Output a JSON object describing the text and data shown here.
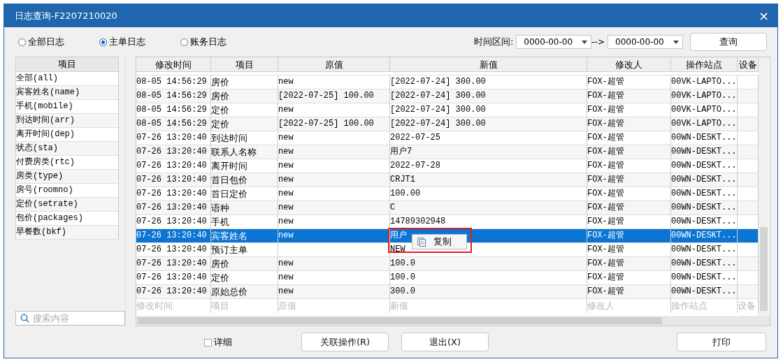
{
  "window": {
    "title": "日志查询-F2207210020",
    "close": "×"
  },
  "log_types": [
    {
      "label": "全部日志",
      "selected": false
    },
    {
      "label": "主单日志",
      "selected": true
    },
    {
      "label": "账务日志",
      "selected": false
    }
  ],
  "time_range": {
    "label": "时间区间:",
    "from": "0000-00-00",
    "arrow": "-->",
    "to": "0000-00-00"
  },
  "query_button": "查询",
  "item_list": {
    "header": "项目",
    "items": [
      {
        "label": "全部(all)",
        "selected": false
      },
      {
        "label": "宾客姓名(name)",
        "selected": false
      },
      {
        "label": "手机(mobile)",
        "selected": false
      },
      {
        "label": "到达时间(arr)",
        "selected": false
      },
      {
        "label": "离开时间(dep)",
        "selected": false
      },
      {
        "label": "状态(sta)",
        "selected": false
      },
      {
        "label": "付费房类(rtc)",
        "selected": false
      },
      {
        "label": "房类(type)",
        "selected": false
      },
      {
        "label": "房号(roomno)",
        "selected": false
      },
      {
        "label": "定价(setrate)",
        "selected": false
      },
      {
        "label": "包价(packages)",
        "selected": false
      },
      {
        "label": "早餐数(bkf)",
        "selected": false
      }
    ],
    "search": {
      "placeholder": "搜索内容"
    }
  },
  "table": {
    "columns": [
      "修改时间",
      "项目",
      "原值",
      "新值",
      "修改人",
      "操作站点",
      "设备"
    ],
    "rows": [
      {
        "time": "08-05 14:56:29",
        "item": "房价",
        "old": "new",
        "new": "[2022-07-24] 300.00",
        "user": "FOX-超管",
        "station": "00VK-LAPTO...",
        "selected": false
      },
      {
        "time": "08-05 14:56:29",
        "item": "房价",
        "old": "[2022-07-25] 100.00",
        "new": "[2022-07-24] 300.00",
        "user": "FOX-超管",
        "station": "00VK-LAPTO...",
        "selected": false
      },
      {
        "time": "08-05 14:56:29",
        "item": "定价",
        "old": "new",
        "new": "[2022-07-24] 300.00",
        "user": "FOX-超管",
        "station": "00VK-LAPTO...",
        "selected": false
      },
      {
        "time": "08-05 14:56:29",
        "item": "定价",
        "old": "[2022-07-25] 100.00",
        "new": "[2022-07-24] 300.00",
        "user": "FOX-超管",
        "station": "00VK-LAPTO...",
        "selected": false
      },
      {
        "time": "07-26 13:20:40",
        "item": "到达时间",
        "old": "new",
        "new": "2022-07-25",
        "user": "FOX-超管",
        "station": "00WN-DESKT...",
        "selected": false
      },
      {
        "time": "07-26 13:20:40",
        "item": "联系人名称",
        "old": "new",
        "new": "用户7",
        "user": "FOX-超管",
        "station": "00WN-DESKT...",
        "selected": false
      },
      {
        "time": "07-26 13:20:40",
        "item": "离开时间",
        "old": "new",
        "new": "2022-07-28",
        "user": "FOX-超管",
        "station": "00WN-DESKT...",
        "selected": false
      },
      {
        "time": "07-26 13:20:40",
        "item": "首日包价",
        "old": "new",
        "new": "CRJT1",
        "user": "FOX-超管",
        "station": "00WN-DESKT...",
        "selected": false
      },
      {
        "time": "07-26 13:20:40",
        "item": "首日定价",
        "old": "new",
        "new": "100.00",
        "user": "FOX-超管",
        "station": "00WN-DESKT...",
        "selected": false
      },
      {
        "time": "07-26 13:20:40",
        "item": "语种",
        "old": "new",
        "new": "C",
        "user": "FOX-超管",
        "station": "00WN-DESKT...",
        "selected": false
      },
      {
        "time": "07-26 13:20:40",
        "item": "手机",
        "old": "new",
        "new": "14789302948",
        "user": "FOX-超管",
        "station": "00WN-DESKT...",
        "selected": false
      },
      {
        "time": "07-26 13:20:40",
        "item": "宾客姓名",
        "old": "new",
        "new": "用户",
        "user": "FOX-超管",
        "station": "00WN-DESKT...",
        "selected": true
      },
      {
        "time": "07-26 13:20:40",
        "item": "预订主单",
        "old": "",
        "new": "NEW",
        "user": "FOX-超管",
        "station": "00WN-DESKT...",
        "selected": false
      },
      {
        "time": "07-26 13:20:40",
        "item": "房价",
        "old": "new",
        "new": "100.0",
        "user": "FOX-超管",
        "station": "00WN-DESKT...",
        "selected": false
      },
      {
        "time": "07-26 13:20:40",
        "item": "定价",
        "old": "new",
        "new": "100.0",
        "user": "FOX-超管",
        "station": "00WN-DESKT...",
        "selected": false
      },
      {
        "time": "07-26 13:20:40",
        "item": "原始总价",
        "old": "new",
        "new": "300.0",
        "user": "FOX-超管",
        "station": "00WN-DESKT...",
        "selected": false
      }
    ],
    "filter_row": [
      "修改时间",
      "项目",
      "原值",
      "新值",
      "修改人",
      "操作站点",
      "设备"
    ]
  },
  "context_menu": {
    "items": [
      {
        "label": "复制"
      }
    ]
  },
  "detail_checkbox": {
    "label": "详细",
    "checked": false
  },
  "buttons": [
    "关联操作(R)",
    "退出(X)",
    "打印"
  ]
}
